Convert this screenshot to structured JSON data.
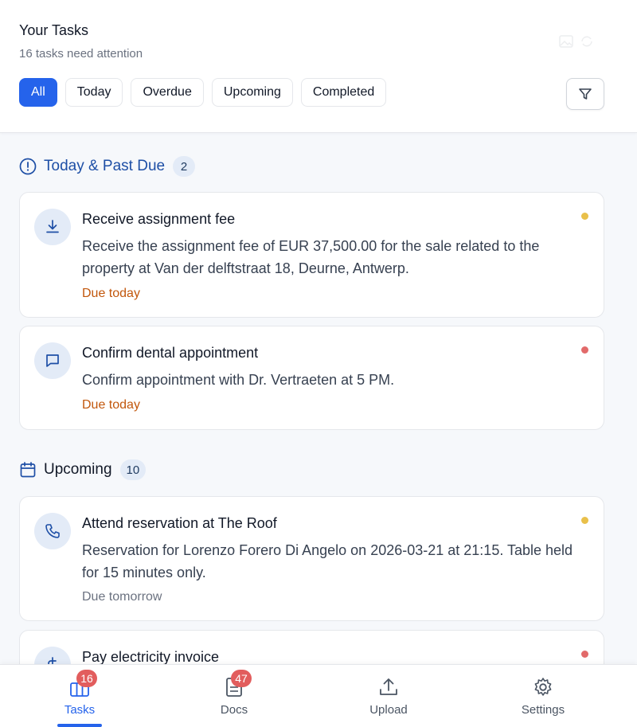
{
  "header": {
    "title": "Your Tasks",
    "subtitle": "16 tasks need attention",
    "tabs": [
      {
        "label": "All",
        "active": true
      },
      {
        "label": "Today",
        "active": false
      },
      {
        "label": "Overdue",
        "active": false
      },
      {
        "label": "Upcoming",
        "active": false
      },
      {
        "label": "Completed",
        "active": false
      }
    ],
    "filter_icon": "filter-icon"
  },
  "sections": [
    {
      "label": "Today & Past Due",
      "count": "2",
      "icon": "alert-circle-icon",
      "tasks": [
        {
          "title": "Receive assignment fee",
          "description": "Receive the assignment fee of EUR 37,500.00 for the sale related to the property at Van der delftstraat 18, Deurne, Antwerp.",
          "due": "Due today",
          "icon": "download-icon",
          "priority_color": "#e9c04a"
        },
        {
          "title": "Confirm dental appointment",
          "description": "Confirm appointment with Dr. Vertraeten at 5 PM.",
          "due": "Due today",
          "icon": "message-icon",
          "priority_color": "#e26a6a"
        }
      ]
    },
    {
      "label": "Upcoming",
      "count": "10",
      "icon": "calendar-icon",
      "tasks": [
        {
          "title": "Attend reservation at The Roof",
          "description": "Reservation for Lorenzo Forero Di Angelo on 2026-03-21 at 21:15. Table held for 15 minutes only.",
          "due": "Due tomorrow",
          "icon": "phone-icon",
          "priority_color": "#e9c04a"
        },
        {
          "title": "Pay electricity invoice",
          "icon": "dollar-icon",
          "priority_color": "#e26a6a"
        }
      ]
    }
  ],
  "bottom_nav": [
    {
      "label": "Tasks",
      "badge": "16",
      "icon": "tasks-icon",
      "active": true
    },
    {
      "label": "Docs",
      "badge": "47",
      "icon": "docs-icon",
      "active": false
    },
    {
      "label": "Upload",
      "icon": "upload-icon",
      "active": false
    },
    {
      "label": "Settings",
      "icon": "gear-icon",
      "active": false
    }
  ],
  "colors": {
    "accent": "#2563eb",
    "due_today": "#c2570c",
    "badge": "#e25d5d"
  }
}
